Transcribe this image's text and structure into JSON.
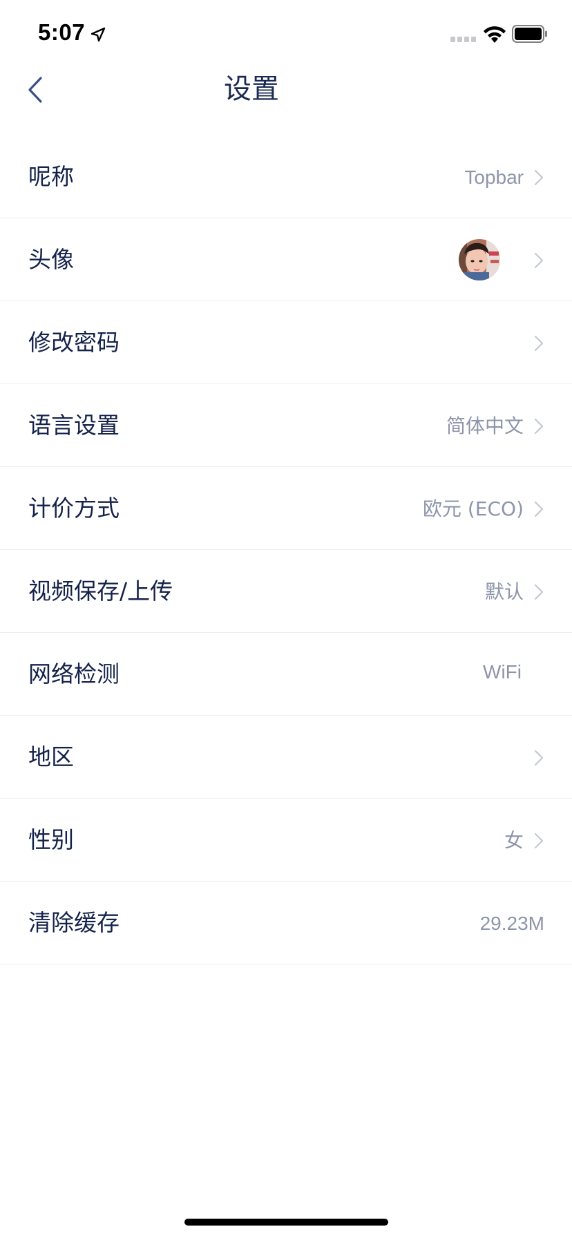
{
  "status_bar": {
    "time": "5:07",
    "icons": [
      "location-arrow-icon",
      "signal-icon",
      "wifi-icon",
      "battery-icon"
    ]
  },
  "nav": {
    "title": "设置",
    "back_icon": "chevron-left-icon"
  },
  "settings": {
    "items": [
      {
        "label": "呢称",
        "value": "Topbar",
        "chevron": true
      },
      {
        "label": "头像",
        "value": "",
        "avatar": true,
        "chevron": true
      },
      {
        "label": "修改密码",
        "value": "",
        "chevron": true
      },
      {
        "label": "语言设置",
        "value": "简体中文",
        "chevron": true
      },
      {
        "label": "计价方式",
        "value": "欧元 (ECO)",
        "chevron": true
      },
      {
        "label": "视频保存/上传",
        "value": "默认",
        "chevron": true
      },
      {
        "label": "网络检测",
        "value": "WiFi",
        "chevron": false
      },
      {
        "label": "地区",
        "value": "",
        "chevron": true
      },
      {
        "label": "性别",
        "value": "女",
        "chevron": true
      },
      {
        "label": "清除缓存",
        "value": "29.23M",
        "chevron": false
      }
    ]
  },
  "colors": {
    "title": "#1a2a52",
    "label": "#15224a",
    "value": "#8c95aa",
    "divider": "#eceef2",
    "accent_back": "#3a4f85"
  }
}
